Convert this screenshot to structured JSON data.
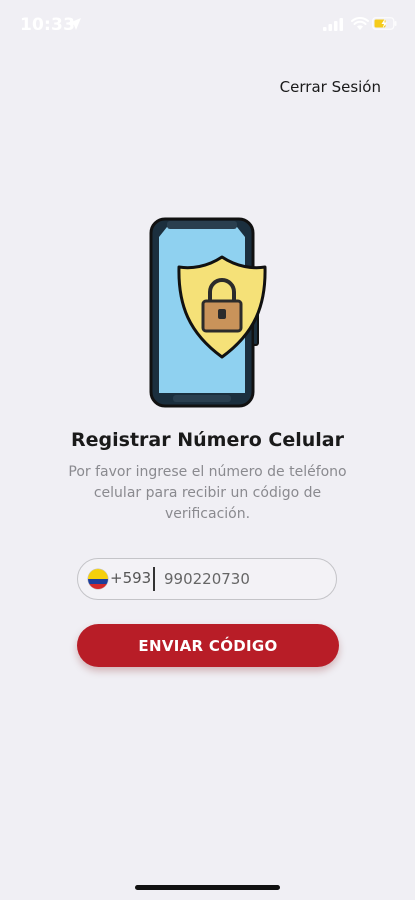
{
  "status_bar": {
    "time": "10:33",
    "icons": [
      "location-arrow-icon",
      "cellular-signal-icon",
      "wifi-icon",
      "battery-charging-icon"
    ]
  },
  "header": {
    "logout_label": "Cerrar Sesión"
  },
  "hero": {
    "icon": "phone-shield-lock-illustration"
  },
  "content": {
    "title": "Registrar Número Celular",
    "subtitle": "Por favor ingrese el número de teléfono celular para recibir un código de verificación."
  },
  "phone_field": {
    "country_flag": "ecuador-flag-icon",
    "country_code": "+593",
    "placeholder": "990220730",
    "value": ""
  },
  "submit_button": {
    "label": "ENVIAR CÓDIGO"
  },
  "colors": {
    "background": "#f0eff4",
    "accent": "#b81d27",
    "shield": "#f5e178",
    "phone_screen": "#8fd1f0"
  }
}
